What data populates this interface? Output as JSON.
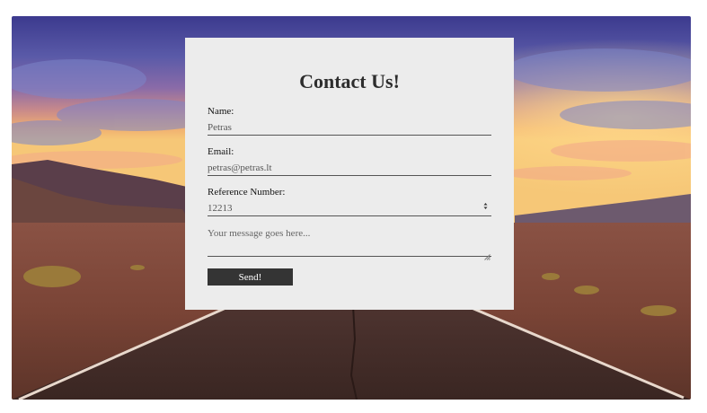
{
  "page": {
    "title": "Contact Us!"
  },
  "form": {
    "name": {
      "label": "Name:",
      "value": "Petras"
    },
    "email": {
      "label": "Email:",
      "value": "petras@petras.lt"
    },
    "reference": {
      "label": "Reference Number:",
      "value": "12213"
    },
    "message": {
      "placeholder": "Your message goes here..."
    },
    "submit_label": "Send!"
  },
  "colors": {
    "card_background": "#ececec",
    "button_background": "#343434",
    "button_text": "#ffffff"
  },
  "icons": {
    "spinner": "number-spinner-icon",
    "resize": "resize-grip-icon"
  },
  "background": "desert-road-sunset-photo"
}
